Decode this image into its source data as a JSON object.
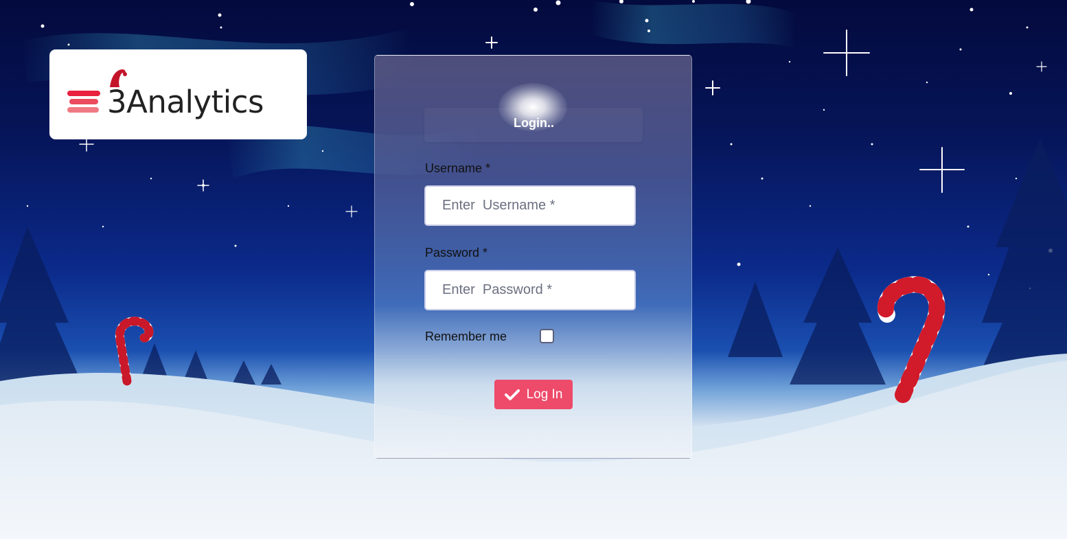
{
  "brand": {
    "name": "3Analytics",
    "accent": "#e8213f"
  },
  "login": {
    "title": "Login..",
    "username": {
      "label": "Username *",
      "placeholder": "Enter  Username *",
      "value": ""
    },
    "password": {
      "label": "Password *",
      "placeholder": "Enter  Password *",
      "value": ""
    },
    "remember": {
      "label": "Remember me",
      "checked": false
    },
    "submit": {
      "label": "Log In",
      "icon": "check-icon",
      "color": "#ee4a6a"
    }
  },
  "background": {
    "theme": "winter-night-snow-candy-canes"
  }
}
